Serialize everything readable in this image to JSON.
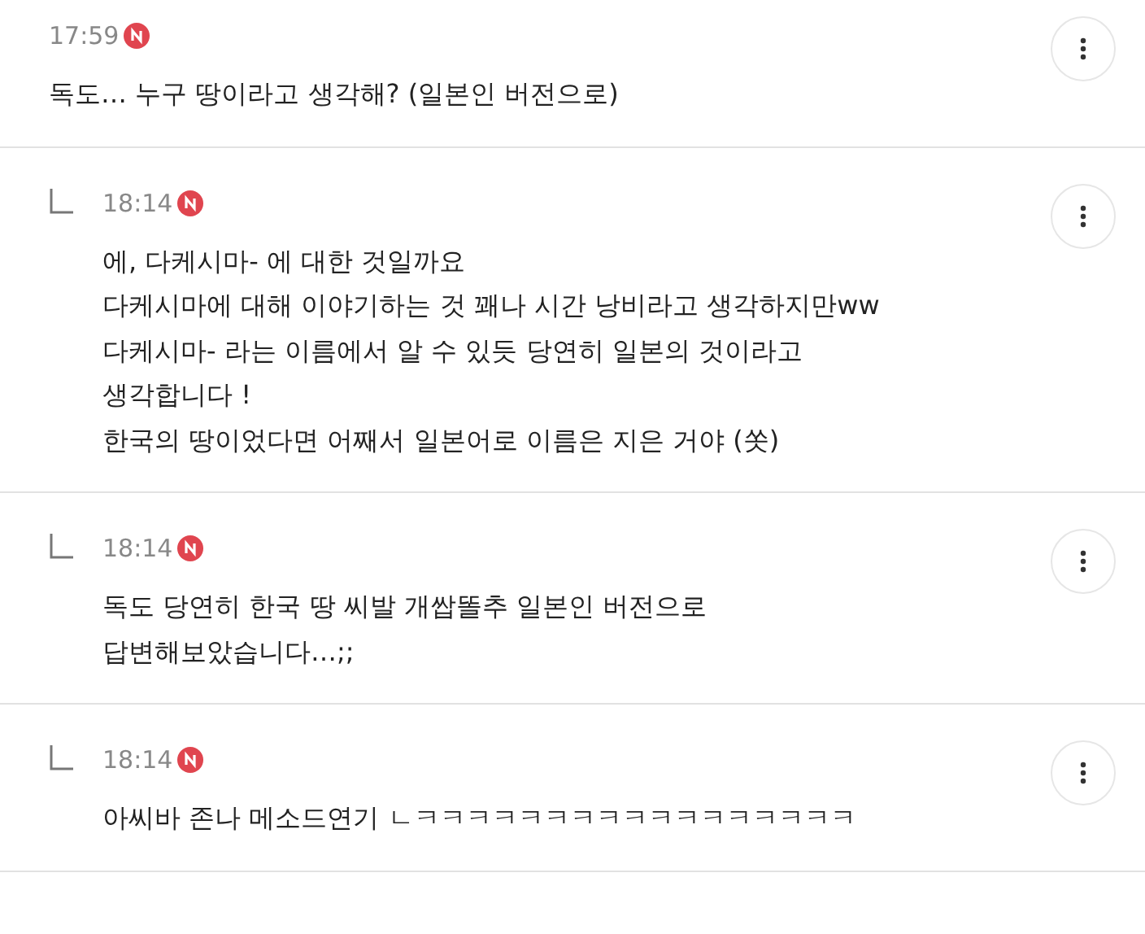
{
  "comments": [
    {
      "kind": "comment",
      "time": "17:59",
      "is_new": true,
      "lines": [
        "독도… 누구 땅이라고 생각해?  (일본인 버전으로)"
      ]
    },
    {
      "kind": "reply",
      "time": "18:14",
      "is_new": true,
      "lines": [
        "에, 다케시마- 에 대한 것일까요",
        "다케시마에 대해 이야기하는 것 꽤나 시간 낭비라고 생각하지만ww",
        "다케시마- 라는 이름에서 알 수 있듯 당연히 일본의 것이라고",
        "생각합니다 !",
        "한국의 땅이었다면 어째서 일본어로 이름은 지은 거야 (쏫)"
      ]
    },
    {
      "kind": "reply",
      "time": "18:14",
      "is_new": true,
      "lines": [
        "독도 당연히 한국 땅 씨발 개쌉똘추 일본인 버전으로",
        "답변해보았습니다…;;"
      ]
    },
    {
      "kind": "reply",
      "time": "18:14",
      "is_new": true,
      "lines": [
        "아씨바 존나 메소드연기 ㄴㅋㅋㅋㅋㅋㅋㅋㅋㅋㅋㅋㅋㅋㅋㅋㅋㅋ"
      ]
    }
  ]
}
